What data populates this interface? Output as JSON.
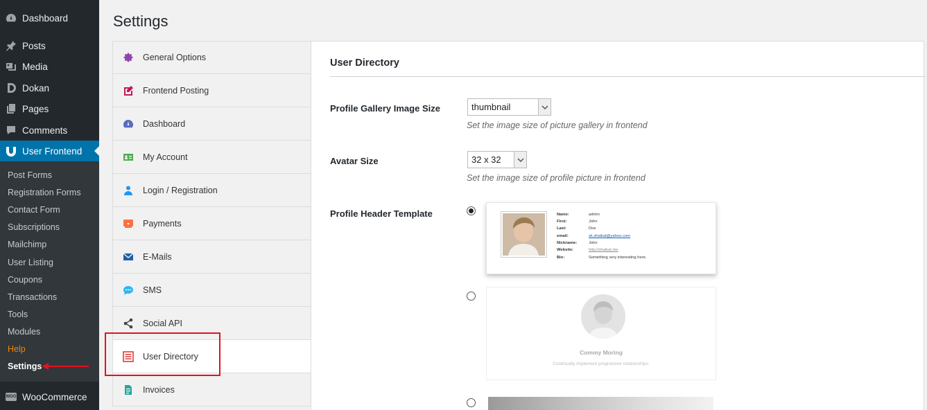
{
  "admin_menu": {
    "items": [
      {
        "label": "Dashboard",
        "icon": "dashboard-icon"
      },
      {
        "label": "Posts",
        "icon": "pin-icon"
      },
      {
        "label": "Media",
        "icon": "media-icon"
      },
      {
        "label": "Dokan",
        "icon": "dokan-icon"
      },
      {
        "label": "Pages",
        "icon": "pages-icon"
      },
      {
        "label": "Comments",
        "icon": "comment-icon"
      },
      {
        "label": "User Frontend",
        "icon": "user-frontend-icon"
      }
    ],
    "submenu": [
      "Post Forms",
      "Registration Forms",
      "Contact Form",
      "Subscriptions",
      "Mailchimp",
      "User Listing",
      "Coupons",
      "Transactions",
      "Tools",
      "Modules",
      "Help",
      "Settings"
    ],
    "woocommerce": {
      "label": "WooCommerce",
      "icon_text": "WOO"
    }
  },
  "page": {
    "title": "Settings"
  },
  "tabs": [
    {
      "label": "General Options",
      "icon": "gear-icon",
      "color": "#8e44ad"
    },
    {
      "label": "Frontend Posting",
      "icon": "edit-icon",
      "color": "#c2185b"
    },
    {
      "label": "Dashboard",
      "icon": "dashboard-icon",
      "color": "#5c6bc0"
    },
    {
      "label": "My Account",
      "icon": "id-card-icon",
      "color": "#4caf50"
    },
    {
      "label": "Login / Registration",
      "icon": "user-icon",
      "color": "#2196f3"
    },
    {
      "label": "Payments",
      "icon": "payment-icon",
      "color": "#ff7043"
    },
    {
      "label": "E-Mails",
      "icon": "envelope-icon",
      "color": "#1e5fa8"
    },
    {
      "label": "SMS",
      "icon": "chat-icon",
      "color": "#29b6f6"
    },
    {
      "label": "Social API",
      "icon": "share-icon",
      "color": "#444444"
    },
    {
      "label": "User Directory",
      "icon": "list-icon",
      "color": "#e53935"
    },
    {
      "label": "Invoices",
      "icon": "invoice-icon",
      "color": "#26a69a"
    }
  ],
  "active_tab": "User Directory",
  "section": {
    "title": "User Directory",
    "gallery_size": {
      "label": "Profile Gallery Image Size",
      "value": "thumbnail",
      "description": "Set the image size of picture gallery in frontend"
    },
    "avatar_size": {
      "label": "Avatar Size",
      "value": "32 x 32",
      "description": "Set the image size of profile picture in frontend"
    },
    "header_template": {
      "label": "Profile Header Template",
      "selected_index": 0,
      "template1": {
        "rows": [
          {
            "key": "Name:",
            "value": "admin"
          },
          {
            "key": "First:",
            "value": "John"
          },
          {
            "key": "Last:",
            "value": "Doe"
          },
          {
            "key": "email:",
            "value": "sk.shaikat@yahoo.com"
          },
          {
            "key": "Nickname:",
            "value": "John"
          },
          {
            "key": "Website:",
            "value": "http://shaikat.me"
          },
          {
            "key": "Bio:",
            "value": "Something very interesting here."
          }
        ]
      },
      "template2": {
        "name": "Commy Moring",
        "tagline": "Continually implement progressive relationships."
      }
    }
  },
  "colors": {
    "accent": "#0073aa",
    "sidebar_bg": "#23282d",
    "submenu_bg": "#32373c",
    "highlight": "#e0121f",
    "help": "#f18500"
  }
}
